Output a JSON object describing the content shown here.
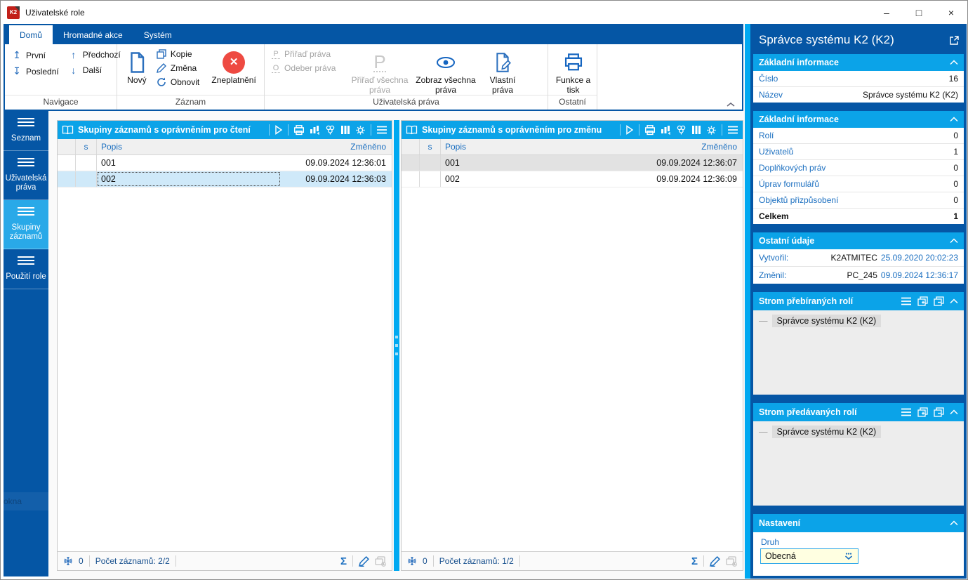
{
  "window": {
    "title": "Uživatelské role",
    "logo": "K2",
    "controls": {
      "minimize": "–",
      "maximize": "□",
      "close": "×"
    }
  },
  "ribbon": {
    "tabs": [
      {
        "label": "Domů",
        "active": true
      },
      {
        "label": "Hromadné akce",
        "active": false
      },
      {
        "label": "Systém",
        "active": false
      }
    ],
    "nav": {
      "label": "Navigace",
      "first": "První",
      "last": "Poslední",
      "prev": "Předchozí",
      "next": "Další"
    },
    "record": {
      "label": "Záznam",
      "new": "Nový",
      "copy": "Kopie",
      "change": "Změna",
      "refresh": "Obnovit",
      "invalidate": "Zneplatnění"
    },
    "rights": {
      "label": "Uživatelská práva",
      "assign": "Přiřaď práva",
      "remove": "Odeber práva",
      "assign_all": "Přiřaď všechna práva",
      "show_all": "Zobraz všechna práva",
      "own": "Vlastní práva"
    },
    "other": {
      "label": "Ostatní",
      "functions": "Funkce a tisk"
    }
  },
  "sidebar": {
    "items": [
      {
        "label": "Seznam",
        "active": false
      },
      {
        "label": "Uživatelská práva",
        "active": false
      },
      {
        "label": "Skupiny záznamů",
        "active": true
      },
      {
        "label": "Použití role",
        "active": false
      }
    ],
    "ghost": "okna"
  },
  "grid_left": {
    "title": "Skupiny záznamů s oprávněním pro čtení",
    "columns": {
      "s": "s",
      "popis": "Popis",
      "zmeneno": "Změněno"
    },
    "rows": [
      {
        "popis": "001",
        "zmeneno": "09.09.2024 12:36:01"
      },
      {
        "popis": "002",
        "zmeneno": "09.09.2024 12:36:03"
      }
    ],
    "status": {
      "flag_count": "0",
      "record_count": "Počet záznamů: 2/2"
    }
  },
  "grid_right": {
    "title": "Skupiny záznamů s oprávněním pro změnu",
    "columns": {
      "s": "s",
      "popis": "Popis",
      "zmeneno": "Změněno"
    },
    "rows": [
      {
        "popis": "001",
        "zmeneno": "09.09.2024 12:36:07"
      },
      {
        "popis": "002",
        "zmeneno": "09.09.2024 12:36:09"
      }
    ],
    "status": {
      "flag_count": "0",
      "record_count": "Počet záznamů: 1/2"
    }
  },
  "panel": {
    "title": "Správce systému K2 (K2)",
    "basic1": {
      "header": "Základní informace",
      "rows": [
        {
          "label": "Číslo",
          "value": "16"
        },
        {
          "label": "Název",
          "value": "Správce systému K2 (K2)"
        }
      ]
    },
    "basic2": {
      "header": "Základní informace",
      "rows": [
        {
          "label": "Rolí",
          "value": "0"
        },
        {
          "label": "Uživatelů",
          "value": "1"
        },
        {
          "label": "Doplňkových práv",
          "value": "0"
        },
        {
          "label": "Úprav formulářů",
          "value": "0"
        },
        {
          "label": "Objektů přizpůsobení",
          "value": "0"
        }
      ],
      "total_label": "Celkem",
      "total_value": "1"
    },
    "other": {
      "header": "Ostatní údaje",
      "rows": [
        {
          "label": "Vytvořil:",
          "user": "K2ATMITEC",
          "date": "25.09.2020 20:02:23"
        },
        {
          "label": "Změnil:",
          "user": "PC_245",
          "date": "09.09.2024 12:36:17"
        }
      ]
    },
    "tree_inherited": {
      "header": "Strom přebíraných rolí",
      "item": "Správce systému K2 (K2)"
    },
    "tree_passed": {
      "header": "Strom předávaných rolí",
      "item": "Správce systému K2 (K2)"
    },
    "settings": {
      "header": "Nastavení",
      "field_label": "Druh",
      "field_value": "Obecná"
    }
  },
  "colors": {
    "dark_blue": "#0556a5",
    "cyan": "#0ba3e8",
    "accent_text": "#1b6fc0",
    "selected_row": "#cfe9f9",
    "invalid_red": "#ee4a42",
    "input_yellow": "#ffffe1",
    "active_sidebar": "#29a9e8"
  }
}
